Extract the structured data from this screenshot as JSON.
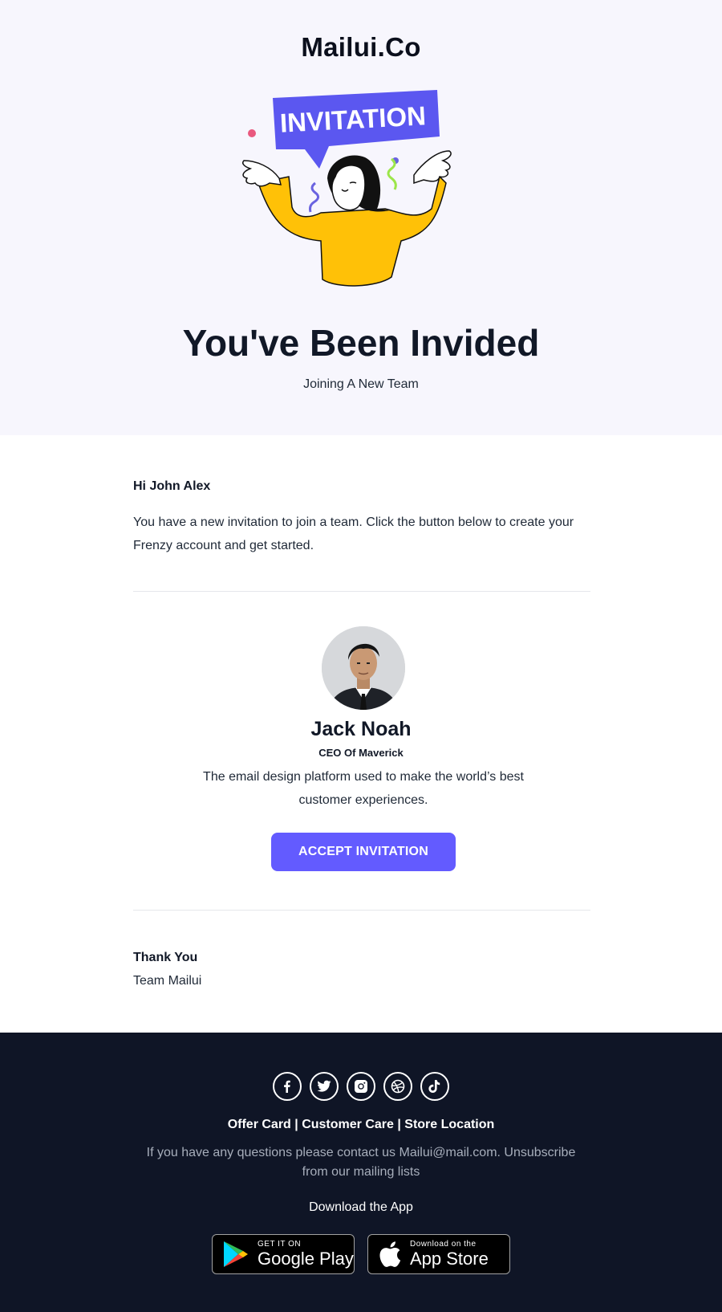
{
  "hero": {
    "brand": "Mailui.Co",
    "banner_text": "INVITATION",
    "title": "You've Been Invided",
    "subtitle": "Joining A New Team"
  },
  "message": {
    "greeting": "Hi John Alex",
    "body": "You have a new invitation to join a team. Click the button below to create your Frenzy account and get started."
  },
  "inviter": {
    "name": "Jack Noah",
    "role": "CEO Of Maverick",
    "description": "The email design platform used to make the world’s best customer experiences.",
    "button_label": "ACCEPT INVITATION"
  },
  "signoff": {
    "thanks": "Thank You",
    "team": "Team Mailui"
  },
  "footer": {
    "socials": [
      "facebook-icon",
      "twitter-icon",
      "instagram-icon",
      "dribbble-icon",
      "tiktok-icon"
    ],
    "links": [
      "Offer Card",
      "Customer Care",
      "Store Location"
    ],
    "separator": " | ",
    "note": "If you have any questions please contact us Mailui@mail.com. Unsubscribe from our mailing lists",
    "download_label": "Download the App",
    "google_play": {
      "small": "GET IT ON",
      "big": "Google Play"
    },
    "app_store": {
      "small": "Download on the",
      "big": "App Store"
    }
  },
  "colors": {
    "accent": "#635bff",
    "hero_bg": "#f7f6fd",
    "footer_bg": "#0f1526",
    "shirt": "#ffc107"
  }
}
